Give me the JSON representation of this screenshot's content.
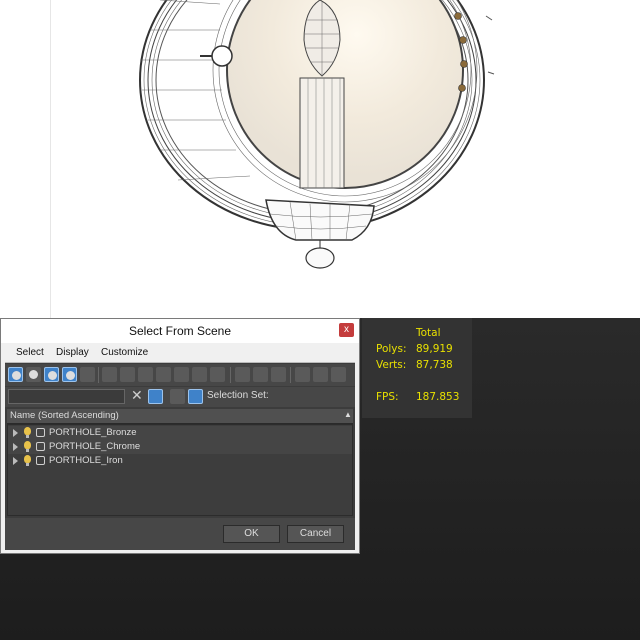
{
  "dialog": {
    "title": "Select From Scene",
    "close_glyph": "x",
    "menu": [
      "Select",
      "Display",
      "Customize"
    ],
    "selection_set_label": "Selection Set:",
    "clear_glyph": "✕",
    "column_header": "Name (Sorted Ascending)",
    "sort_glyph": "▲",
    "items": [
      {
        "name": "PORTHOLE_Bronze"
      },
      {
        "name": "PORTHOLE_Chrome"
      },
      {
        "name": "PORTHOLE_Iron"
      }
    ],
    "ok_label": "OK",
    "cancel_label": "Cancel"
  },
  "stats": {
    "header": "Total",
    "polys_label": "Polys:",
    "polys_value": "89,919",
    "verts_label": "Verts:",
    "verts_value": "87,738",
    "fps_label": "FPS:",
    "fps_value": "187.853"
  },
  "colors": {
    "accent": "#3f82c9",
    "stats_text": "#e8e000",
    "close_button": "#c43c3c"
  }
}
